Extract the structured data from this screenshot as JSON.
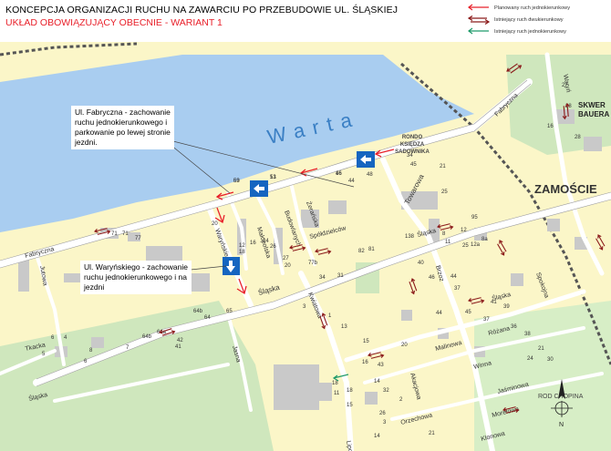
{
  "header": {
    "title": "KONCEPCJA ORGANIZACJI RUCHU NA ZAWARCIU PO PRZEBUDOWIE UL. ŚLĄSKIEJ",
    "subtitle": "UKŁAD OBOWIĄZUJĄCY OBECNIE - WARIANT 1"
  },
  "legend": [
    {
      "label": "Planowany ruch jednokierunkowy",
      "color": "#e8202a",
      "icon": "single-arrow-icon"
    },
    {
      "label": "Istniejący ruch dwukierunkowy",
      "color": "#8b1a1a",
      "icon": "double-arrow-icon"
    },
    {
      "label": "Istniejący ruch jednokierunkowy",
      "color": "#1f9a6a",
      "icon": "single-arrow-icon"
    }
  ],
  "map": {
    "river": "Warta",
    "district": "ZAMOŚCIE",
    "rondo": [
      "RONDO",
      "KSIĘDZA",
      "SADOWNIKA"
    ],
    "skwer": [
      "SKWER",
      "BAUERA"
    ],
    "park": "ROD CHOPINA",
    "streets": {
      "fabryczna_w": "Fabryczna",
      "fabryczna_ne": "Fabryczna",
      "slaska_w": "Śląska",
      "slaska_c": "Śląska",
      "slaska_e": "Śląska",
      "slaska_se": "Śląska",
      "warynskiego": "Waryńskiego",
      "zeranska": "Żerańska",
      "budowlanych": "Budowlanych",
      "malopolska": "Małopolska",
      "spoldzielcow": "Spółdzielców",
      "towarowa": "Towarowa",
      "kwiatowa": "Kwiatowa",
      "jutowa": "Jutowa",
      "tkacka": "Tkacka",
      "jasna": "Jasna",
      "malinowa": "Malinowa",
      "rozana": "Różana",
      "winna": "Winna",
      "jasminowa": "Jaśminowa",
      "morelowa": "Morelowa",
      "klonowa": "Klonowa",
      "orzechowa": "Orzechowa",
      "akacjowa": "Akacjowa",
      "spokojna": "Spokojna",
      "brzoz": "Brzoz",
      "waryn_ne": "Waryń",
      "lipowa": "Lipo"
    },
    "house_numbers": [
      "53",
      "51",
      "46",
      "44",
      "48",
      "34",
      "45",
      "21",
      "25",
      "77",
      "71",
      "71",
      "20",
      "12",
      "18",
      "16",
      "24",
      "26",
      "27",
      "20",
      "77b",
      "82",
      "81",
      "31",
      "34",
      "95",
      "12",
      "8",
      "11",
      "25",
      "12a",
      "8a",
      "138",
      "40",
      "46",
      "44",
      "65",
      "64b",
      "64",
      "64b",
      "64a",
      "42",
      "41",
      "6",
      "4",
      "5",
      "8",
      "6",
      "7",
      "3",
      "1",
      "13",
      "15",
      "43",
      "44",
      "37",
      "45",
      "41",
      "39",
      "37",
      "16",
      "18",
      "14",
      "32",
      "36",
      "38",
      "21",
      "24",
      "30",
      "18",
      "11",
      "15",
      "20",
      "26",
      "3",
      "2",
      "21",
      "14",
      "16",
      "28",
      "27",
      "28",
      "69",
      "13",
      "16"
    ]
  },
  "callouts": [
    {
      "line1": "Ul. Fabryczna - zachowanie",
      "line2": "ruchu jednokierunkowego i",
      "line3": "parkowanie po lewej stronie",
      "line4": "jezdni."
    },
    {
      "line1": "Ul. Waryńskiego - zachowanie",
      "line2": "ruchu jednokierunkowego i na",
      "line3": "jezdni"
    }
  ],
  "colors": {
    "river": "#a9cdf0",
    "land": "#fbf6c8",
    "green": "#cfe7bd",
    "road": "#ffffff",
    "building": "#c9c9c9",
    "planned": "#e8202a",
    "two_way": "#8b1a1a",
    "one_way_existing": "#1f9a6a",
    "sign": "#1565c0"
  }
}
